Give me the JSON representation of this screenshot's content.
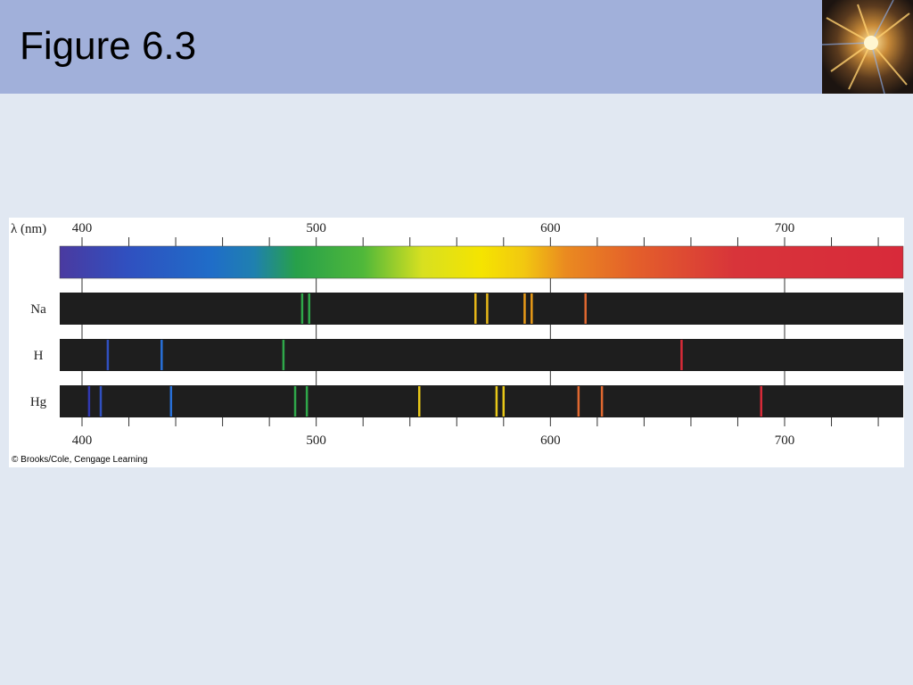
{
  "slide": {
    "title": "Figure 6.3",
    "credit": "© Brooks/Cole, Cengage Learning"
  },
  "figure": {
    "axis_label": "λ (nm)",
    "range_nm": [
      390,
      750
    ],
    "major_ticks": [
      400,
      500,
      600,
      700
    ],
    "minor_tick_step": 20,
    "colors": {
      "band_bg": "#1e1e1e",
      "violet": "#4a3aa0",
      "blue": "#1f6dc8",
      "green": "#27a04a",
      "yellow": "#f5e400",
      "orange": "#e87828",
      "red": "#d82a38"
    },
    "rows": [
      {
        "element": "Na",
        "lines": [
          {
            "nm": 494,
            "color": "#2fa84a"
          },
          {
            "nm": 497,
            "color": "#2fa84a"
          },
          {
            "nm": 568,
            "color": "#e8b818"
          },
          {
            "nm": 573,
            "color": "#e8b818"
          },
          {
            "nm": 589,
            "color": "#e89a18"
          },
          {
            "nm": 592,
            "color": "#e89a18"
          },
          {
            "nm": 615,
            "color": "#e06830"
          }
        ]
      },
      {
        "element": "H",
        "lines": [
          {
            "nm": 411,
            "color": "#3050c0"
          },
          {
            "nm": 434,
            "color": "#2870d8"
          },
          {
            "nm": 486,
            "color": "#2fa84a"
          },
          {
            "nm": 656,
            "color": "#d82a38"
          }
        ]
      },
      {
        "element": "Hg",
        "lines": [
          {
            "nm": 403,
            "color": "#3038b0"
          },
          {
            "nm": 408,
            "color": "#3050c0"
          },
          {
            "nm": 438,
            "color": "#2870d8"
          },
          {
            "nm": 491,
            "color": "#2fa84a"
          },
          {
            "nm": 496,
            "color": "#2fa84a"
          },
          {
            "nm": 544,
            "color": "#e8c818"
          },
          {
            "nm": 577,
            "color": "#e8c818"
          },
          {
            "nm": 580,
            "color": "#e8c818"
          },
          {
            "nm": 612,
            "color": "#e06830"
          },
          {
            "nm": 622,
            "color": "#e06830"
          },
          {
            "nm": 690,
            "color": "#d82a38"
          }
        ]
      }
    ]
  }
}
